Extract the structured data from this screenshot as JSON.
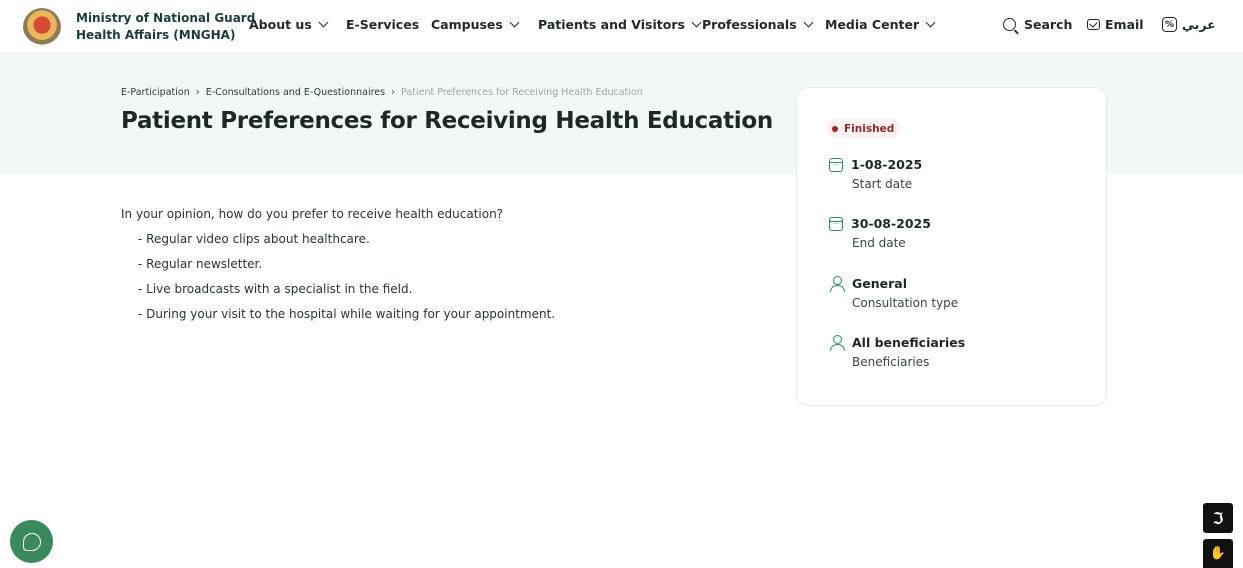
{
  "header": {
    "org_name_line1": "Ministry of National Guard",
    "org_name_line2": "Health Affairs (MNGHA)",
    "nav": [
      {
        "label": "About us",
        "dropdown": true
      },
      {
        "label": "E-Services",
        "dropdown": false
      },
      {
        "label": "Campuses",
        "dropdown": true
      },
      {
        "label": "Patients and Visitors",
        "dropdown": true
      },
      {
        "label": "Professionals",
        "dropdown": true
      },
      {
        "label": "Media Center",
        "dropdown": true
      }
    ],
    "search_label": "Search",
    "email_label": "Email",
    "language_label": "عربي"
  },
  "breadcrumb": {
    "items": [
      "E-Participation",
      "E-Consultations and E-Questionnaires"
    ],
    "current": "Patient Preferences for Receiving Health Education"
  },
  "page": {
    "title": "Patient Preferences for Receiving Health Education",
    "question": "In your opinion, how do you prefer to receive health education?",
    "options": [
      "- Regular video clips about healthcare.",
      "- Regular newsletter.",
      "- Live broadcasts with a specialist in the field.",
      "- During your visit to the hospital while waiting for your appointment."
    ]
  },
  "card": {
    "status": "Finished",
    "start_date": {
      "value": "1-08-2025",
      "label": "Start date"
    },
    "end_date": {
      "value": "30-08-2025",
      "label": "End date"
    },
    "consultation_type": {
      "value": "General",
      "label": "Consultation type"
    },
    "beneficiaries": {
      "value": "All beneficiaries",
      "label": "Beneficiaries"
    }
  },
  "colors": {
    "accent": "#2f8a6a",
    "hero_bg": "#f2f9f5",
    "status_bg": "#fdf0f0",
    "status_dot": "#a3222a",
    "chat_fab": "#3a8a5e"
  },
  "icons": {
    "logo": "mngha-emblem",
    "search": "search-icon",
    "email": "email-icon",
    "language": "translate-icon",
    "calendar": "calendar-icon",
    "user": "user-icon",
    "chat": "chat-icon",
    "hearing": "hearing-accessibility-icon",
    "sign_language": "sign-language-icon"
  }
}
